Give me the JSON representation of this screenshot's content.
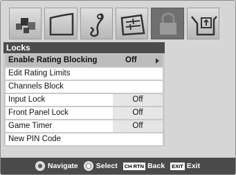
{
  "icons": [
    "picture-icon",
    "sound-icon",
    "setup-icon",
    "preferences-icon",
    "lock-icon",
    "applications-icon"
  ],
  "menu": {
    "title": "Locks",
    "items": [
      {
        "label": "Enable Rating Blocking",
        "value": "Off"
      },
      {
        "label": "Edit Rating Limits",
        "value": ""
      },
      {
        "label": "Channels Block",
        "value": ""
      },
      {
        "label": "Input Lock",
        "value": "Off"
      },
      {
        "label": "Front Panel Lock",
        "value": "Off"
      },
      {
        "label": "Game Timer",
        "value": "Off"
      },
      {
        "label": "New PIN Code",
        "value": ""
      }
    ]
  },
  "footer": {
    "navigate": "Navigate",
    "select": "Select",
    "back_key": "CH RTN",
    "back": "Back",
    "exit_key": "EXIT",
    "exit": "Exit"
  },
  "colors": {
    "title_bar": "#4c4c4c",
    "footer": "#4a4a4a",
    "highlight": "#bdbdbd"
  }
}
